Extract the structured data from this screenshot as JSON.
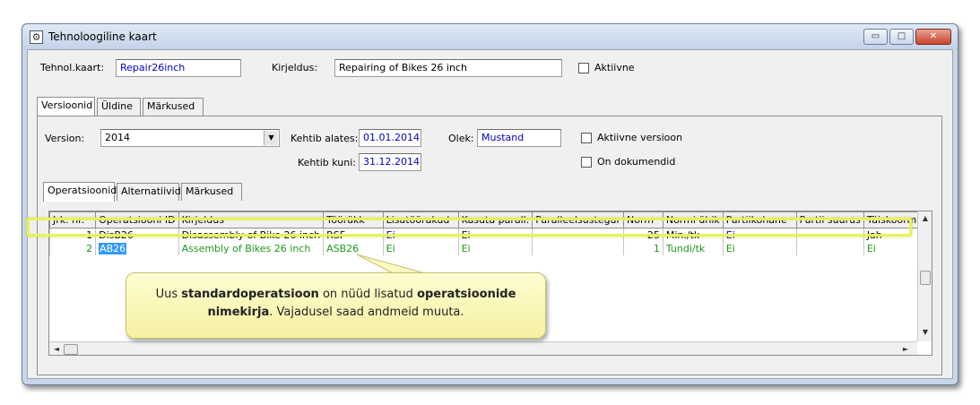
{
  "window": {
    "title": "Tehnoloogiline kaart",
    "app_icon": "gear-window-icon",
    "controls": {
      "minimize": "▭",
      "maximize": "□",
      "close": "✕"
    }
  },
  "header": {
    "tehnol_label": "Tehnol.kaart:",
    "tehnol_value": "Repair26inch",
    "kirjeldus_label": "Kirjeldus:",
    "kirjeldus_value": "Repairing of Bikes 26 inch",
    "aktiivne_label": "Aktiivne"
  },
  "outer_tabs": [
    "Versioonid",
    "Üldine",
    "Märkused"
  ],
  "version": {
    "label": "Version:",
    "value": "2014",
    "kehtib_alates_label": "Kehtib alates:",
    "kehtib_alates_value": "01.01.2014",
    "kehtib_kuni_label": "Kehtib kuni:",
    "kehtib_kuni_value": "31.12.2014",
    "olek_label": "Olek:",
    "olek_value": "Mustand",
    "aktiivne_versioon_label": "Aktiivne versioon",
    "on_dokumendid_label": "On dokumendid"
  },
  "inner_tabs": [
    "Operatsioonid",
    "Alternatiivid",
    "Märkused"
  ],
  "grid": {
    "columns": [
      "Jrk. nr.",
      "Operatsiooni ID",
      "Kirjeldus",
      "Tööräkk",
      "Lisatöörakud",
      "Kasuta parall.",
      "Paralleelsustegur",
      "Norm",
      "Normi ühik",
      "Partiikohane",
      "Partii suurus",
      "Täiskoormus"
    ],
    "rows": [
      [
        "1",
        "DisB26",
        "Disassembly of Bike 26 inch",
        "RSF",
        "Ei",
        "Ei",
        "",
        "25",
        "Min./tk",
        "Ei",
        "",
        "Jah"
      ],
      [
        "2",
        "AB26",
        "Assembly of Bikes 26 inch",
        "ASB26",
        "Ei",
        "Ei",
        "",
        "1",
        "Tundi/tk",
        "Ei",
        "",
        "Ei"
      ]
    ]
  },
  "callout": {
    "part1": "Uus ",
    "bold1": "standardoperatsioon",
    "part2": " on nüüd lisatud ",
    "bold2": "operatsioonide nimekirja",
    "part3": ". Vajadusel saad andmeid muuta."
  },
  "colors": {
    "value_blue": "#0000c8",
    "selected_green": "#1a9a1a",
    "highlight_yellow": "#e8f25a"
  }
}
